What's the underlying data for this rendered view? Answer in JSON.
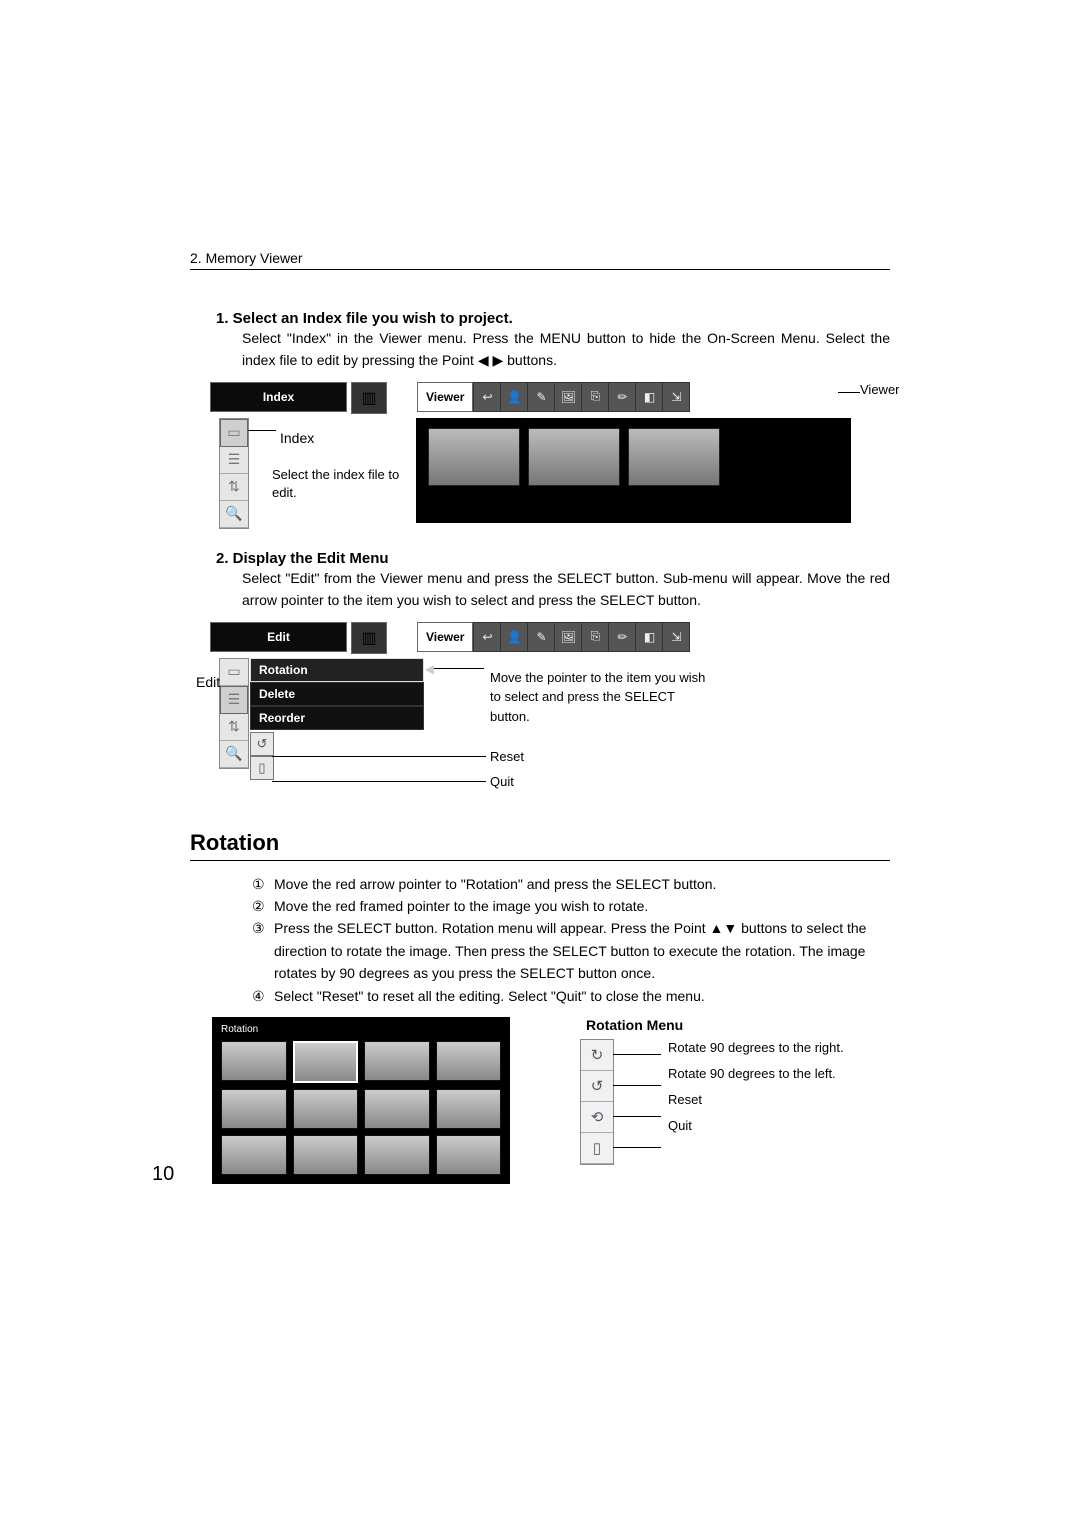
{
  "header": {
    "chapter": "2. Memory Viewer"
  },
  "step1": {
    "title": "1. Select an Index file you wish to project.",
    "body_a": "Select \"Index\" in the Viewer menu.  Press the MENU button to hide the On-Screen Menu.  Select the index file to edit by pressing the Point ",
    "arrows": "◀ ▶",
    "body_b": " buttons."
  },
  "fig1": {
    "menubar_left": "Index",
    "menubar_viewer": "Viewer",
    "viewer_callout": "Viewer",
    "index_label": "Index",
    "select_caption": "Select the index file to edit."
  },
  "step2": {
    "title": "2. Display the Edit Menu",
    "body": "Select \"Edit\" from the Viewer menu and press the SELECT button.  Sub-menu will appear.  Move the red arrow pointer to the item you wish to select and press the SELECT button."
  },
  "fig2": {
    "menubar_left": "Edit",
    "menubar_viewer": "Viewer",
    "edit_label": "Edit",
    "items": {
      "rotation": "Rotation",
      "delete": "Delete",
      "reorder": "Reorder"
    },
    "note": "Move the pointer to the item you wish to select and press the SELECT button.",
    "reset": "Reset",
    "quit": "Quit"
  },
  "rotation": {
    "heading": "Rotation",
    "steps": [
      "Move the red arrow pointer to \"Rotation\" and press the SELECT button.",
      "Move the red framed pointer to the image you wish to rotate.",
      "Press the SELECT button.  Rotation menu will appear.  Press the Point ▲▼ buttons to select the direction to rotate the image.  Then press the SELECT button to execute the rotation.  The image rotates by 90 degrees as you press the SELECT button once.",
      "Select \"Reset\" to reset all the editing.  Select \"Quit\" to close the menu."
    ],
    "nums": [
      "①",
      "②",
      "③",
      "④"
    ]
  },
  "fig3": {
    "preview_title": "Rotation",
    "menu_title": "Rotation Menu",
    "labels": {
      "right": "Rotate 90 degrees to the right.",
      "left": "Rotate 90 degrees to the left.",
      "reset": "Reset",
      "quit": "Quit"
    }
  },
  "icons": {
    "toolbar": [
      "↩",
      "👤",
      "✎",
      "🖼",
      "⎘",
      "✏",
      "◧",
      "⇲"
    ]
  },
  "page_number": "10"
}
